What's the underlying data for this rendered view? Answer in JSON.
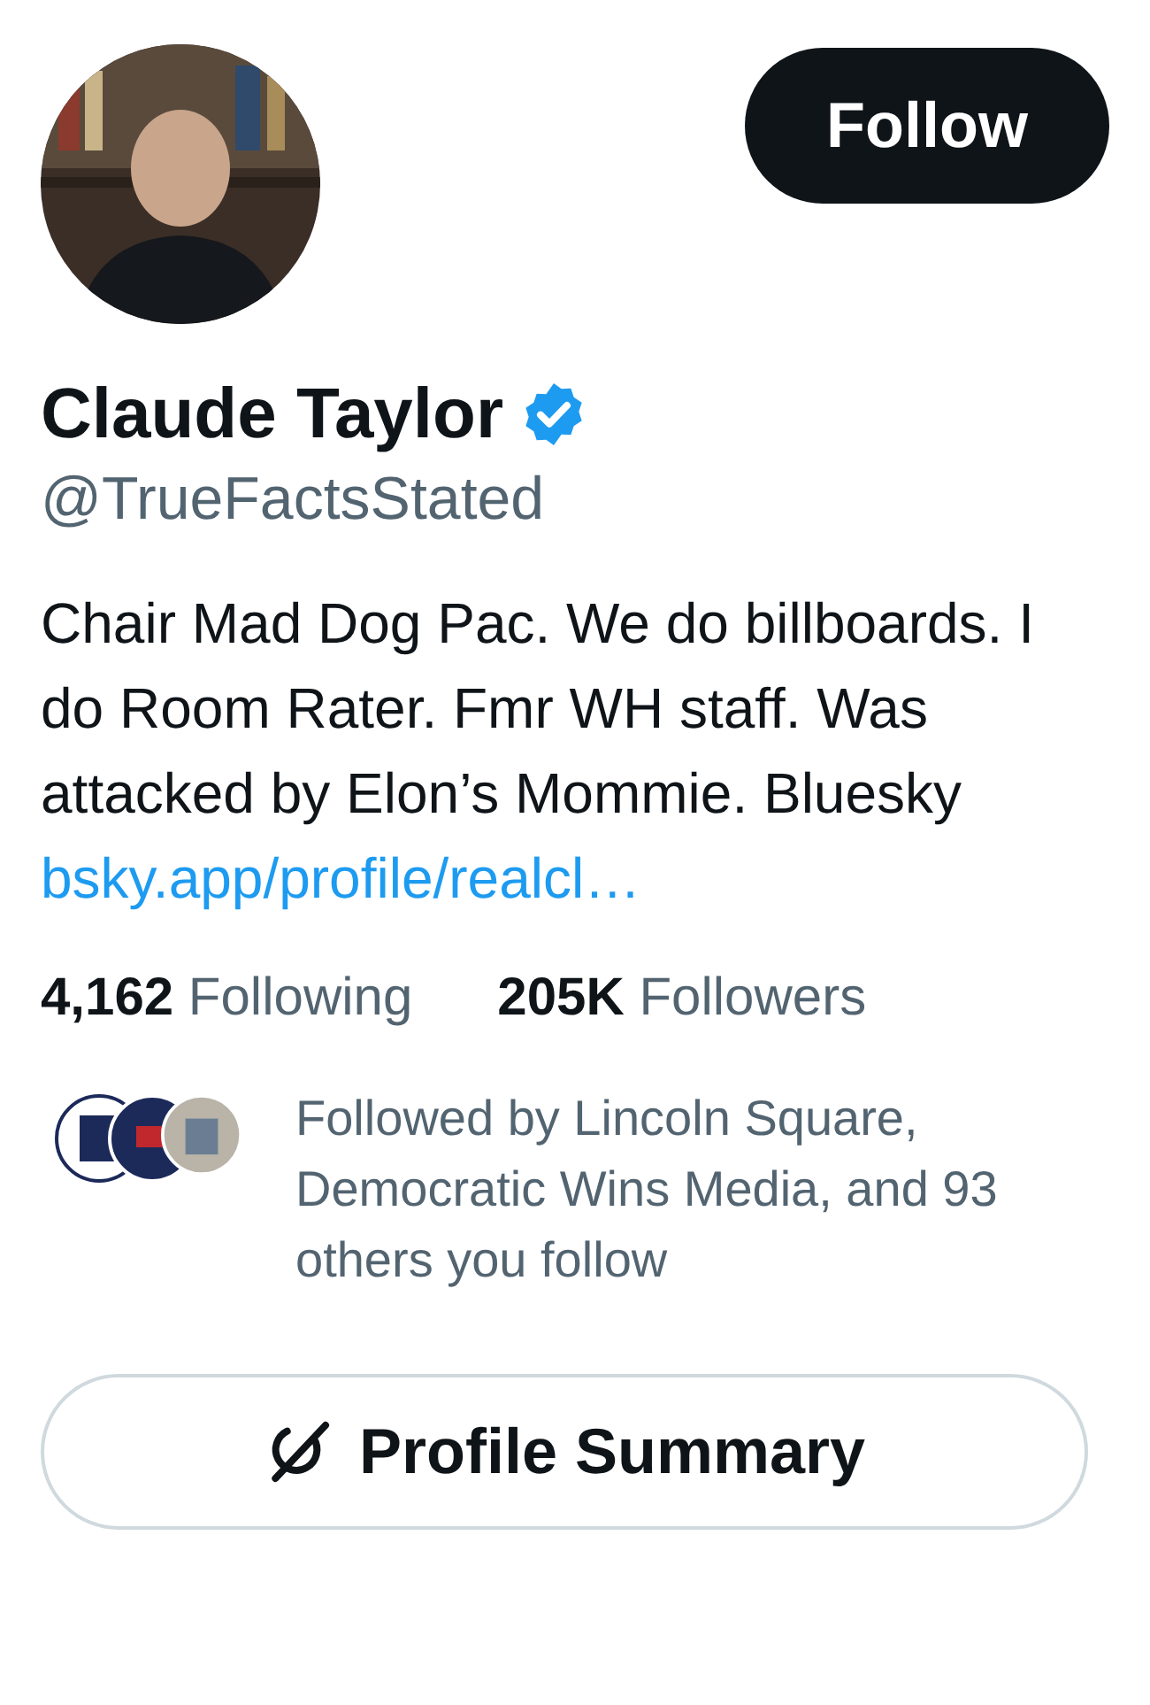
{
  "follow_button": "Follow",
  "profile": {
    "name": "Claude Taylor",
    "verified": true,
    "handle": "@TrueFactsStated",
    "bio": "Chair Mad Dog Pac. We do billboards. I do Room Rater. Fmr WH staff. Was attacked by Elon’s Mommie. Bluesky",
    "link": "bsky.app/profile/realcl…"
  },
  "stats": [
    {
      "count": "4,162",
      "label": "Following"
    },
    {
      "count": "205K",
      "label": "Followers"
    }
  ],
  "followed_by": {
    "text": "Followed by Lincoln Square, Democratic Wins Media, and 93 others you follow"
  },
  "summary_button": "Profile Summary"
}
